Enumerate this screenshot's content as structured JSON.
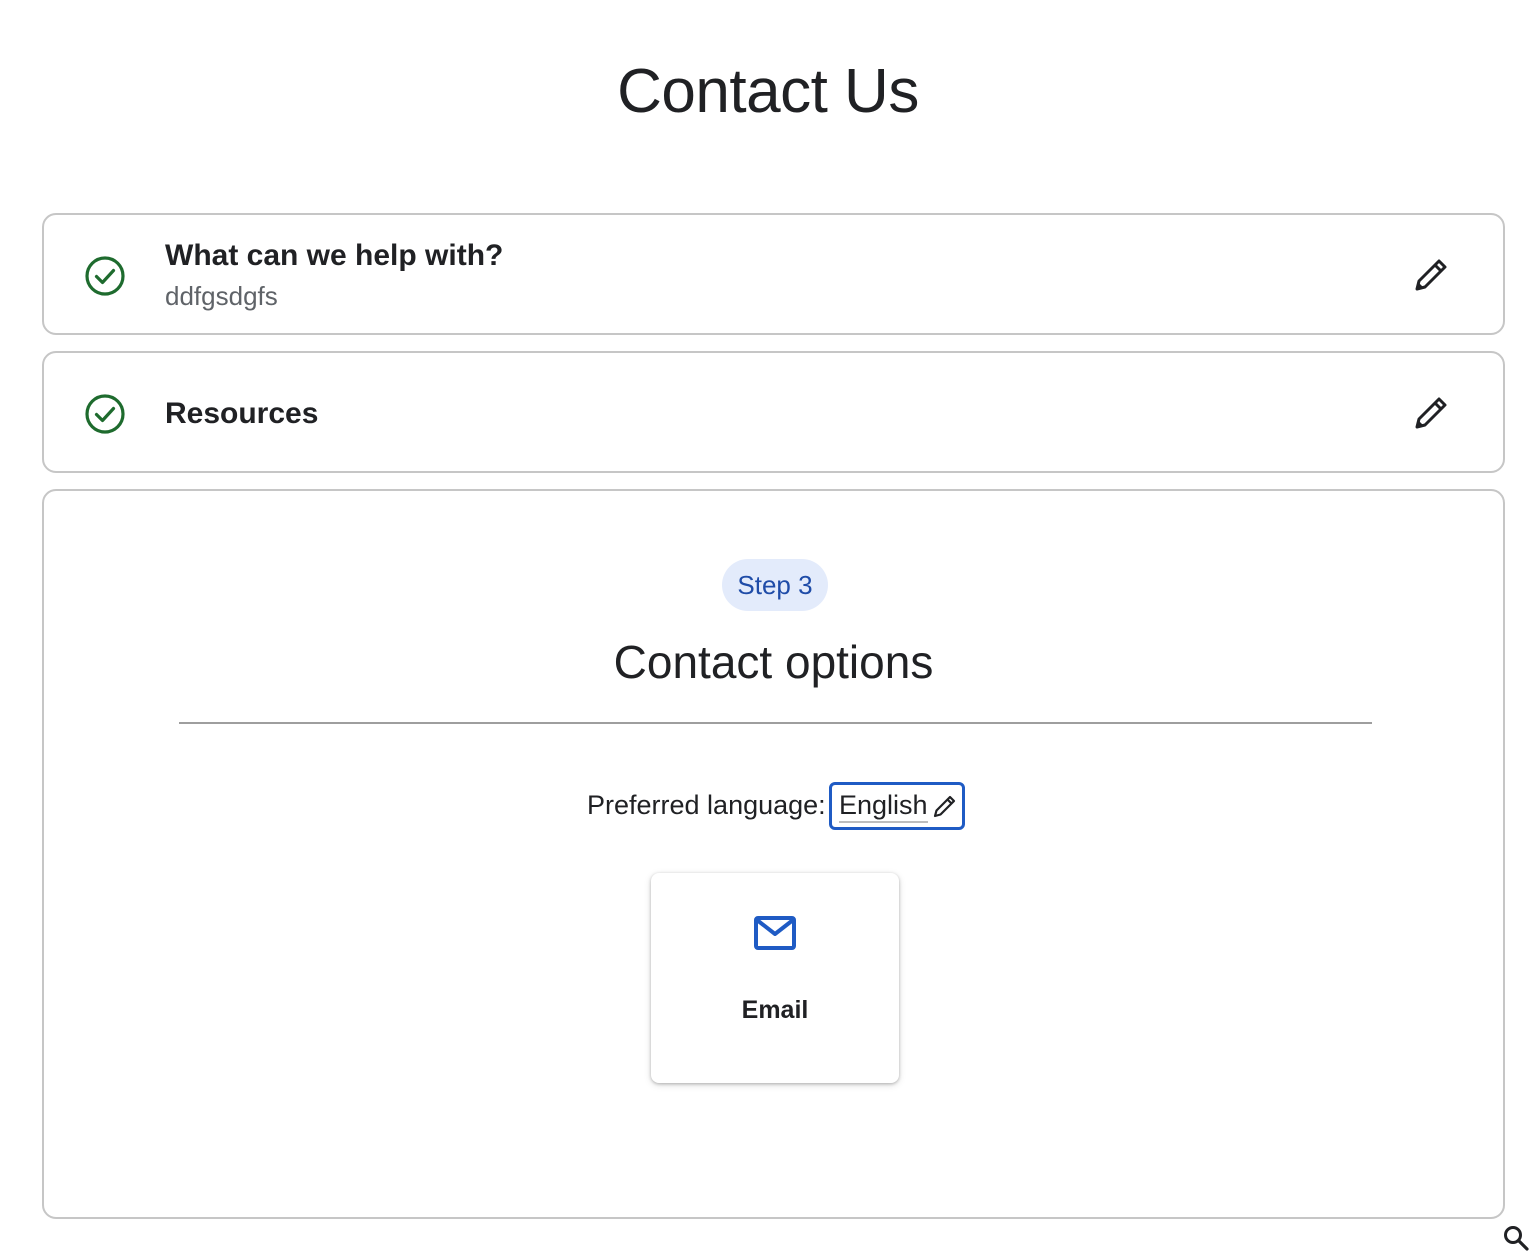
{
  "page": {
    "title": "Contact Us"
  },
  "steps": [
    {
      "heading": "What can we help with?",
      "summary": "ddfgsdgfs",
      "status_icon": "check-circle-icon",
      "edit_icon": "pencil-icon"
    },
    {
      "heading": "Resources",
      "status_icon": "check-circle-icon",
      "edit_icon": "pencil-icon"
    }
  ],
  "active_step": {
    "chip": "Step 3",
    "title": "Contact options",
    "language": {
      "label": "Preferred language:",
      "value": "English",
      "edit_icon": "pencil-icon"
    },
    "options": [
      {
        "label": "Email",
        "icon": "mail-icon"
      }
    ]
  },
  "floating": {
    "icon": "search-icon"
  },
  "colors": {
    "check_green": "#1e6b2e",
    "accent_blue": "#1f5bc4",
    "chip_bg": "#e3ebfb",
    "chip_text": "#1f4ca8",
    "border_gray": "#c6c6c6"
  }
}
